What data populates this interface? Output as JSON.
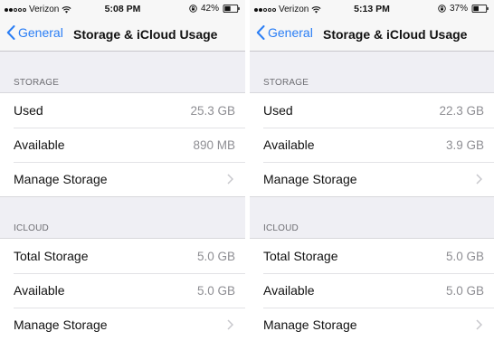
{
  "screens": [
    {
      "status": {
        "carrier": "Verizon",
        "time": "5:08 PM",
        "battery": "42%"
      },
      "nav": {
        "back_label": "General",
        "title": "Storage & iCloud Usage"
      },
      "storage": {
        "header": "STORAGE",
        "used_label": "Used",
        "used_value": "25.3 GB",
        "available_label": "Available",
        "available_value": "890 MB",
        "manage_label": "Manage Storage"
      },
      "icloud": {
        "header": "ICLOUD",
        "total_label": "Total Storage",
        "total_value": "5.0 GB",
        "available_label": "Available",
        "available_value": "5.0 GB",
        "manage_label": "Manage Storage"
      }
    },
    {
      "status": {
        "carrier": "Verizon",
        "time": "5:13 PM",
        "battery": "37%"
      },
      "nav": {
        "back_label": "General",
        "title": "Storage & iCloud Usage"
      },
      "storage": {
        "header": "STORAGE",
        "used_label": "Used",
        "used_value": "22.3 GB",
        "available_label": "Available",
        "available_value": "3.9 GB",
        "manage_label": "Manage Storage"
      },
      "icloud": {
        "header": "ICLOUD",
        "total_label": "Total Storage",
        "total_value": "5.0 GB",
        "available_label": "Available",
        "available_value": "5.0 GB",
        "manage_label": "Manage Storage"
      }
    }
  ],
  "colors": {
    "accent": "#2a7ef5",
    "background": "#efeff4",
    "bar": "#f7f7f7",
    "secondary_text": "#8e8e93"
  },
  "icons": [
    "signal-dots",
    "wifi",
    "rotation-lock",
    "battery",
    "back-chevron",
    "disclosure-chevron"
  ]
}
